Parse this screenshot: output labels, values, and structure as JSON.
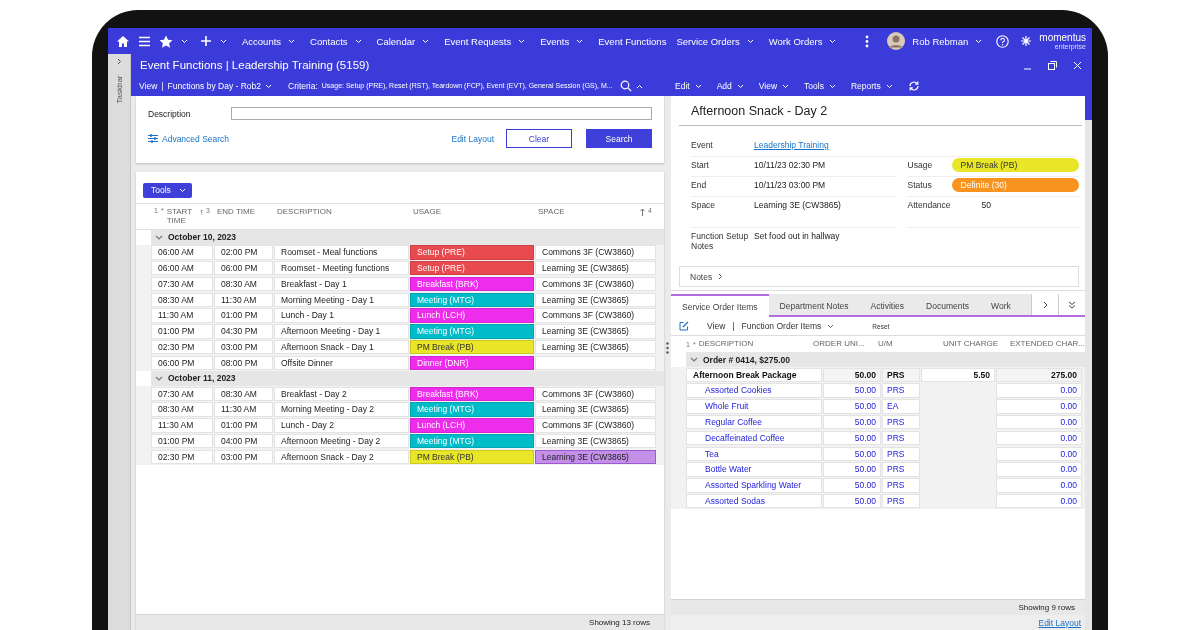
{
  "nav": {
    "items": [
      {
        "label": "Accounts",
        "dropdown": true
      },
      {
        "label": "Contacts",
        "dropdown": true
      },
      {
        "label": "Calendar",
        "dropdown": true
      },
      {
        "label": "Event Requests",
        "dropdown": true
      },
      {
        "label": "Events",
        "dropdown": true
      },
      {
        "label": "Event Functions",
        "dropdown": false
      },
      {
        "label": "Service Orders",
        "dropdown": true
      },
      {
        "label": "Work Orders",
        "dropdown": true
      }
    ],
    "user": "Rob Rebman",
    "logo": {
      "name": "momentus",
      "tagline": "enterprise"
    }
  },
  "taskbar": {
    "label": "Taskbar"
  },
  "window": {
    "title": "Event Functions | Leadership Training (5159)"
  },
  "toolbar": {
    "view": "View",
    "separator": "|",
    "layout": "Functions by Day - Rob2",
    "criteria_label": "Criteria:",
    "criteria": "Usage: Setup (PRE), Reset (RST), Teardown (FCP), Event (EVT), General Session (GS), M...",
    "actions": [
      "Edit",
      "Add",
      "View",
      "Tools",
      "Reports"
    ]
  },
  "search": {
    "label": "Description",
    "advanced": "Advanced Search",
    "edit_layout": "Edit Layout",
    "clear": "Clear",
    "submit": "Search"
  },
  "grid": {
    "tools": "Tools",
    "index": "1",
    "star": "*",
    "columns": [
      {
        "label": "START TIME",
        "sort": "3"
      },
      {
        "label": "END TIME"
      },
      {
        "label": "DESCRIPTION"
      },
      {
        "label": "USAGE"
      },
      {
        "label": "SPACE",
        "sort": "4"
      }
    ],
    "groups": [
      {
        "label": "October 10, 2023",
        "expanded": true,
        "rows": [
          {
            "start": "06:00 AM",
            "end": "02:00 PM",
            "description": "Roomset - Meal functions",
            "usage": "Setup (PRE)",
            "color": "#e84a4f",
            "space": "Commons 3F (CW3860)",
            "selected": false
          },
          {
            "start": "06:00 AM",
            "end": "06:00 PM",
            "description": "Roomset - Meeting functions",
            "usage": "Setup (PRE)",
            "color": "#e84a4f",
            "space": "Learning 3E (CW3865)",
            "selected": false
          },
          {
            "start": "07:30 AM",
            "end": "08:30 AM",
            "description": "Breakfast - Day 1",
            "usage": "Breakfast (BRK)",
            "color": "#ee2cec",
            "space": "Commons 3F (CW3860)",
            "selected": false
          },
          {
            "start": "08:30 AM",
            "end": "11:30 AM",
            "description": "Morning Meeting - Day 1",
            "usage": "Meeting (MTG)",
            "color": "#00bcc9",
            "space": "Learning 3E (CW3865)",
            "selected": false
          },
          {
            "start": "11:30 AM",
            "end": "01:00 PM",
            "description": "Lunch - Day 1",
            "usage": "Lunch (LCH)",
            "color": "#ee2cec",
            "space": "Commons 3F (CW3860)",
            "selected": false
          },
          {
            "start": "01:00 PM",
            "end": "04:30 PM",
            "description": "Afternoon Meeting - Day 1",
            "usage": "Meeting (MTG)",
            "color": "#00bcc9",
            "space": "Learning 3E (CW3865)",
            "selected": false
          },
          {
            "start": "02:30 PM",
            "end": "03:00 PM",
            "description": "Afternoon Snack - Day 1",
            "usage": "PM Break (PB)",
            "color": "#e9e627",
            "space": "Learning 3E (CW3865)",
            "selected": false
          },
          {
            "start": "06:00 PM",
            "end": "08:00 PM",
            "description": "Offsite Dinner",
            "usage": "Dinner (DNR)",
            "color": "#ee2cec",
            "selected": false
          }
        ]
      },
      {
        "label": "October 11, 2023",
        "expanded": true,
        "rows": [
          {
            "start": "07:30 AM",
            "end": "08:30 AM",
            "description": "Breakfast - Day 2",
            "usage": "Breakfast (BRK)",
            "color": "#ee2cec",
            "space": "Commons 3F (CW3860)",
            "selected": false
          },
          {
            "start": "08:30 AM",
            "end": "11:30 AM",
            "description": "Morning Meeting - Day 2",
            "usage": "Meeting (MTG)",
            "color": "#00bcc9",
            "space": "Learning 3E (CW3865)",
            "selected": false
          },
          {
            "start": "11:30 AM",
            "end": "01:00 PM",
            "description": "Lunch - Day 2",
            "usage": "Lunch (LCH)",
            "color": "#ee2cec",
            "space": "Commons 3F (CW3860)",
            "selected": false
          },
          {
            "start": "01:00 PM",
            "end": "04:00 PM",
            "description": "Afternoon Meeting - Day 2",
            "usage": "Meeting (MTG)",
            "color": "#00bcc9",
            "space": "Learning 3E (CW3865)",
            "selected": false
          },
          {
            "start": "02:30 PM",
            "end": "03:00 PM",
            "description": "Afternoon Snack - Day 2",
            "usage": "PM Break (PB)",
            "color": "#e9e627",
            "space": "Learning 3E (CW3865)",
            "selected": true
          }
        ]
      }
    ],
    "footer": "Showing 13 rows"
  },
  "details": {
    "title": "Afternoon Snack - Day 2",
    "event": {
      "label": "Event",
      "value": "Leadership Training"
    },
    "left_fields": [
      {
        "label": "Start",
        "value": "10/11/23 02:30 PM"
      },
      {
        "label": "End",
        "value": "10/11/23 03:00 PM"
      },
      {
        "label": "Space",
        "value": "Learning 3E (CW3865)"
      },
      {
        "label": "Function Setup Notes",
        "value": "Set food out in hallway"
      }
    ],
    "right_fields": [
      {
        "label": "Usage",
        "value": "PM Break (PB)",
        "kind": "pill",
        "color": "#e9e627"
      },
      {
        "label": "Status",
        "value": "Definite (30)",
        "kind": "pill",
        "color": "#f7931e"
      },
      {
        "label": "Attendance",
        "value": "50",
        "kind": "text"
      }
    ],
    "notes": "Notes"
  },
  "tabs": [
    {
      "label": "Service Order Items",
      "selected": true
    },
    {
      "label": "Department Notes",
      "selected": false
    },
    {
      "label": "Activities",
      "selected": false
    },
    {
      "label": "Documents",
      "selected": false
    },
    {
      "label": "Work",
      "selected": false
    }
  ],
  "order_grid": {
    "view": "View",
    "separator": "|",
    "layout": "Function Order Items",
    "reset": "Reset",
    "index": "1",
    "star": "*",
    "columns": [
      "DESCRIPTION",
      "ORDER UNI...",
      "U/M",
      "UNIT CHARGE",
      "EXTENDED CHAR..."
    ],
    "group": {
      "label": "Order # 0414, $275.00",
      "expanded": true
    },
    "rows": [
      {
        "kind": "package",
        "description": "Afternoon Break Package",
        "units": "50.00",
        "um": "PRS",
        "unit_charge": "5.50",
        "extended": "275.00"
      },
      {
        "kind": "item",
        "description": "Assorted Cookies",
        "units": "50.00",
        "um": "PRS",
        "extended": "0.00"
      },
      {
        "kind": "item",
        "description": "Whole Fruit",
        "units": "50.00",
        "um": "EA",
        "extended": "0.00"
      },
      {
        "kind": "item",
        "description": "Regular Coffee",
        "units": "50.00",
        "um": "PRS",
        "extended": "0.00"
      },
      {
        "kind": "item",
        "description": "Decaffeinated Coffee",
        "units": "50.00",
        "um": "PRS",
        "extended": "0.00"
      },
      {
        "kind": "item",
        "description": "Tea",
        "units": "50.00",
        "um": "PRS",
        "extended": "0.00"
      },
      {
        "kind": "item",
        "description": "Bottle Water",
        "units": "50.00",
        "um": "PRS",
        "extended": "0.00"
      },
      {
        "kind": "item",
        "description": "Assorted Sparkling Water",
        "units": "50.00",
        "um": "PRS",
        "extended": "0.00"
      },
      {
        "kind": "item",
        "description": "Assorted Sodas",
        "units": "50.00",
        "um": "PRS",
        "extended": "0.00"
      }
    ],
    "footer": "Showing 9 rows",
    "edit_layout": "Edit Layout"
  }
}
